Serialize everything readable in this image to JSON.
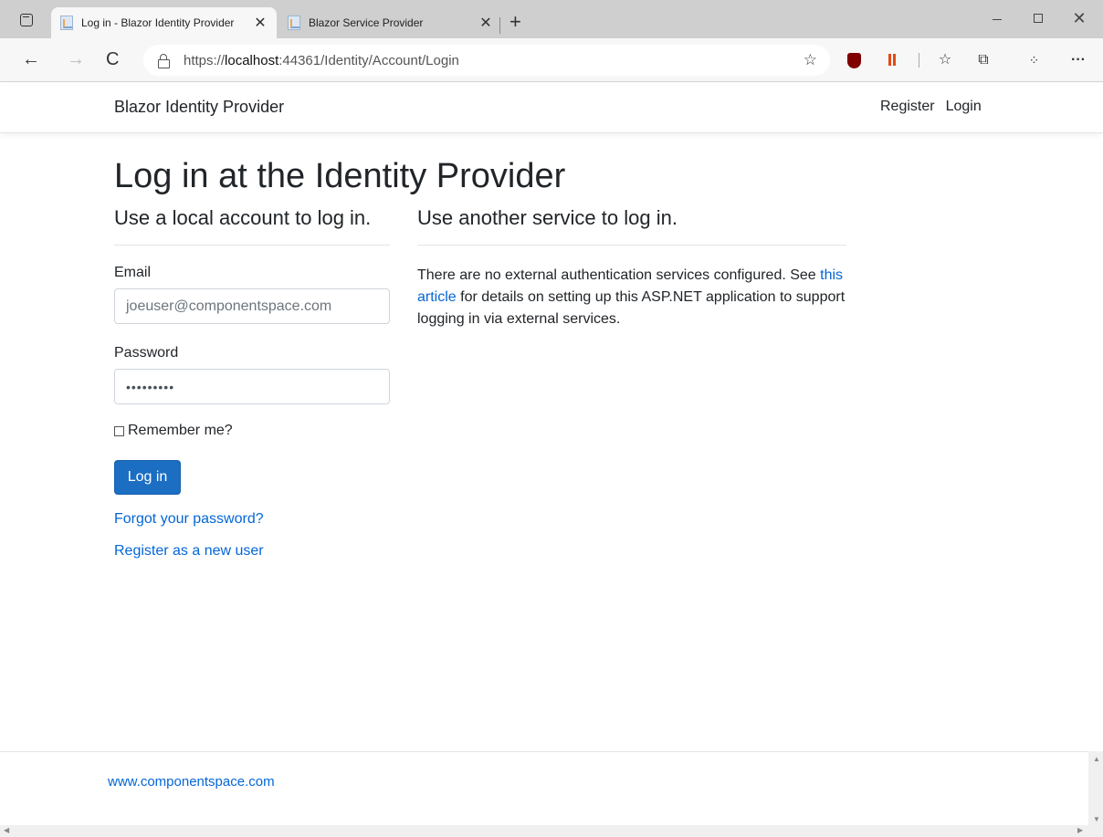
{
  "browser": {
    "tabs": [
      {
        "title": "Log in - Blazor Identity Provider",
        "close": "✕"
      },
      {
        "title": "Blazor Service Provider",
        "close": "✕"
      }
    ],
    "new_tab": "+",
    "url_prefix": "https://",
    "url_host": "localhost",
    "url_rest": ":44361/Identity/Account/Login",
    "icons": {
      "back": "←",
      "forward": "→",
      "reload": "C",
      "add_favorite": "☆",
      "favorites": "☆",
      "collections": "⧉",
      "extensions": "⁘",
      "more": "···",
      "close_window": "✕"
    }
  },
  "navbar": {
    "brand": "Blazor Identity Provider",
    "links": [
      "Register",
      "Login"
    ]
  },
  "main": {
    "title": "Log in at the Identity Provider",
    "local": {
      "heading": "Use a local account to log in.",
      "email_label": "Email",
      "email_value": "joeuser@componentspace.com",
      "password_label": "Password",
      "password_value": "•••••••••",
      "remember_label": "Remember me?",
      "login_button": "Log in",
      "forgot_link": "Forgot your password?",
      "register_link": "Register as a new user"
    },
    "external": {
      "heading": "Use another service to log in.",
      "text_before": "There are no external authentication services configured. See ",
      "link": "this article",
      "text_after": " for details on setting up this ASP.NET application to support logging in via external services."
    }
  },
  "footer": {
    "link": "www.componentspace.com"
  },
  "colors": {
    "primary": "#1b6ec2",
    "link": "#0366d6",
    "text": "#212529"
  }
}
